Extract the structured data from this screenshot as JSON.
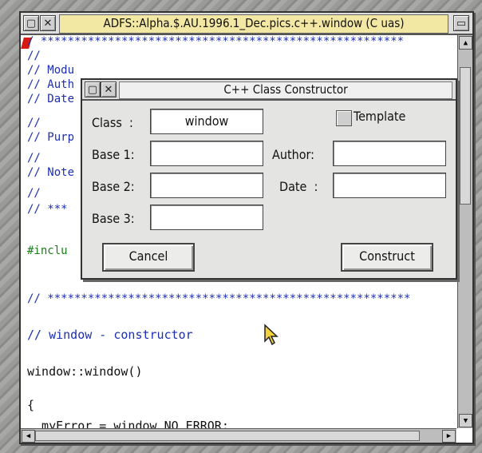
{
  "editor": {
    "title": "ADFS::Alpha.$.AU.1996.1_Dec.pics.c++.window (C uas)",
    "back_icon": "back-icon",
    "close_icon": "close-icon",
    "toggle_icon": "toggle-size-icon",
    "code_lines": [
      {
        "text": "/ ******************************************************",
        "color": "#1d2fb0"
      },
      {
        "text": "//",
        "color": "#1d2fb0"
      },
      {
        "text": "// Modu",
        "color": "#1d2fb0"
      },
      {
        "text": "// Auth",
        "color": "#1d2fb0"
      },
      {
        "text": "// Date",
        "color": "#1d2fb0"
      },
      {
        "text": "//",
        "color": "#1d2fb0"
      },
      {
        "text": "// Purp",
        "color": "#1d2fb0"
      },
      {
        "text": "//",
        "color": "#1d2fb0"
      },
      {
        "text": "// Note",
        "color": "#1d2fb0"
      },
      {
        "text": "//",
        "color": "#1d2fb0"
      },
      {
        "text": "// ***",
        "color": "#1d2fb0"
      },
      {
        "text": "#inclu",
        "color": "#1a7d18"
      },
      {
        "text": "// ******************************************************",
        "color": "#1d2fb0"
      },
      {
        "text": "// window - constructor",
        "color": "#1d2fb0"
      },
      {
        "text": "window::window()",
        "color": "#111111"
      },
      {
        "text": "{",
        "color": "#111111"
      },
      {
        "text": "  myError = window_NO_ERROR;",
        "color": "#111111"
      }
    ]
  },
  "dialog": {
    "title": "C++ Class Constructor",
    "class_label": "Class  :",
    "class_value": "window",
    "template_label": "Template",
    "base1_label": "Base 1:",
    "base2_label": "Base 2:",
    "base3_label": "Base 3:",
    "author_label": "Author:",
    "date_label": "Date  :",
    "base1_value": "",
    "base2_value": "",
    "base3_value": "",
    "author_value": "",
    "date_value": "",
    "cancel_label": "Cancel",
    "construct_label": "Construct"
  },
  "colors": {
    "comment": "#1d2fb0",
    "preprocessor": "#1a7d18",
    "title_bar": "#f2e7a3",
    "cursor_marker": "#d41a12"
  }
}
